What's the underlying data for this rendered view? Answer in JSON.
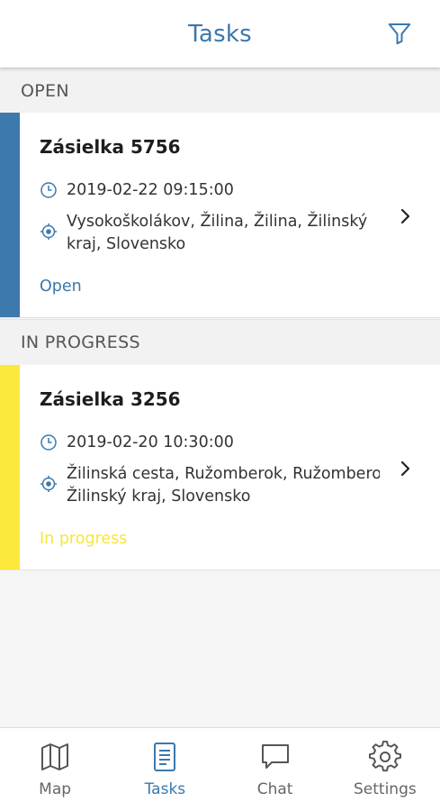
{
  "header": {
    "title": "Tasks",
    "filter_icon": "filter-icon"
  },
  "colors": {
    "accent": "#3a78ad",
    "open_stripe": "#3e79ad",
    "in_progress_stripe": "#fde83c",
    "in_progress_text": "#f6e63d"
  },
  "sections": [
    {
      "label": "OPEN",
      "task": {
        "title": "Zásielka 5756",
        "datetime": "2019-02-22 09:15:00",
        "address_line1": "Vysokoškolákov, Žilina, Žilina, Žilinský",
        "address_line2": "kraj, Slovensko",
        "status": "Open"
      }
    },
    {
      "label": "IN PROGRESS",
      "task": {
        "title": "Zásielka 3256",
        "datetime": "2019-02-20 10:30:00",
        "address_line1": "Žilinská cesta, Ružomberok, Ružomberok,",
        "address_line2": "Žilinský kraj, Slovensko",
        "status": "In progress"
      }
    }
  ],
  "bottom_nav": [
    {
      "label": "Map",
      "icon": "map-icon"
    },
    {
      "label": "Tasks",
      "icon": "tasks-icon",
      "active": true
    },
    {
      "label": "Chat",
      "icon": "chat-icon"
    },
    {
      "label": "Settings",
      "icon": "gear-icon"
    }
  ]
}
